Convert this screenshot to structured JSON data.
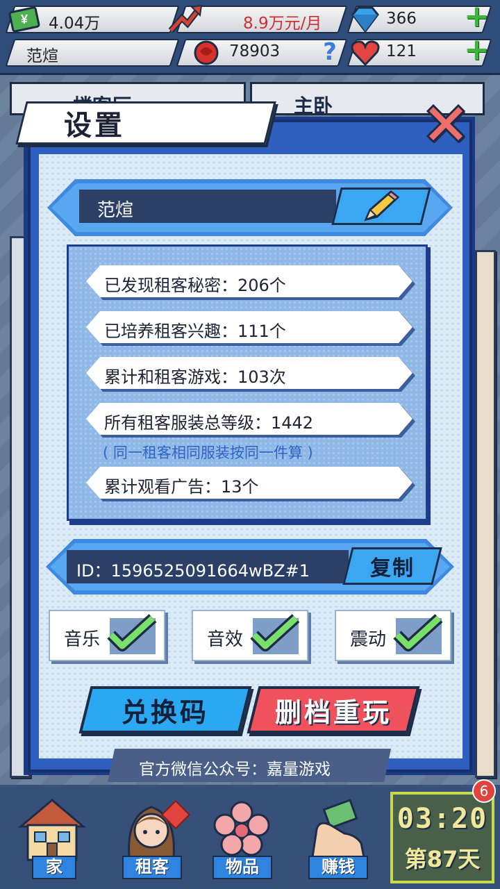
{
  "status": {
    "cash": "4.04万",
    "income": "8.9万元/月",
    "diamonds": "366",
    "player_name": "范煊",
    "reputation": "78903",
    "hearts": "121"
  },
  "background": {
    "tab_left": "一楼客厅",
    "tab_right": "主卧"
  },
  "settings": {
    "title": "设置",
    "player_name": "范煊",
    "stats": [
      "已发现租客秘密：206个",
      "已培养租客兴趣：111个",
      "累计和租客游戏：103次",
      "所有租客服装总等级：1442",
      "累计观看广告：13个"
    ],
    "stats_note": "( 同一租客相同服装按同一件算 )",
    "player_id": "ID：1596525091664wBZ#1",
    "copy_label": "复制",
    "toggles": [
      "音乐",
      "音效",
      "震动"
    ],
    "redeem_label": "兑换码",
    "reset_label": "删档重玩",
    "wechat_text": "官方微信公众号：嘉量游戏"
  },
  "nav": {
    "home": "家",
    "tenants": "租客",
    "items": "物品",
    "earn": "赚钱",
    "time": "03:20",
    "day": "第87天",
    "notification_count": "6"
  },
  "colors": {
    "modal_blue": "#2f5fbe",
    "accent_blue": "#2aa8f2",
    "danger_red": "#f0525d",
    "check_green": "#7be06a"
  }
}
